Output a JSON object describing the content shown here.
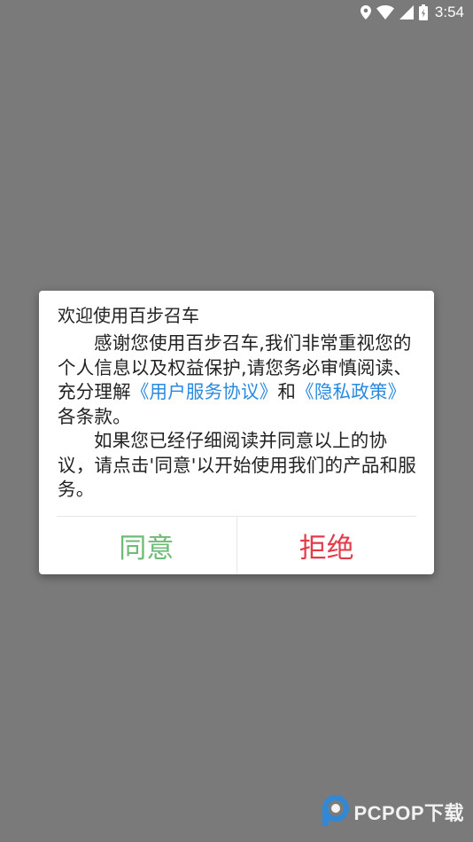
{
  "status_bar": {
    "time": "3:54"
  },
  "dialog": {
    "title": "欢迎使用百步召车",
    "paragraph1_before": "感谢您使用百步召车,我们非常重视您的个人信息以及权益保护,请您务必审慎阅读、充分理解",
    "user_agreement_link": "《用户服务协议》",
    "and_text": "和",
    "privacy_policy_link": "《隐私政策》",
    "paragraph1_after": "各条款。",
    "paragraph2": "如果您已经仔细阅读并同意以上的协议，请点击'同意'以开始使用我们的产品和服务。",
    "agree_label": "同意",
    "reject_label": "拒绝"
  },
  "watermark": {
    "text": "PCPOP下载"
  },
  "colors": {
    "overlay": "#7a7a7a",
    "link": "#2a8adf",
    "agree": "#6dbb74",
    "reject": "#e23b4a"
  },
  "icons": [
    "location-icon",
    "wifi-icon",
    "signal-icon",
    "battery-icon",
    "pcpop-logo-icon"
  ]
}
